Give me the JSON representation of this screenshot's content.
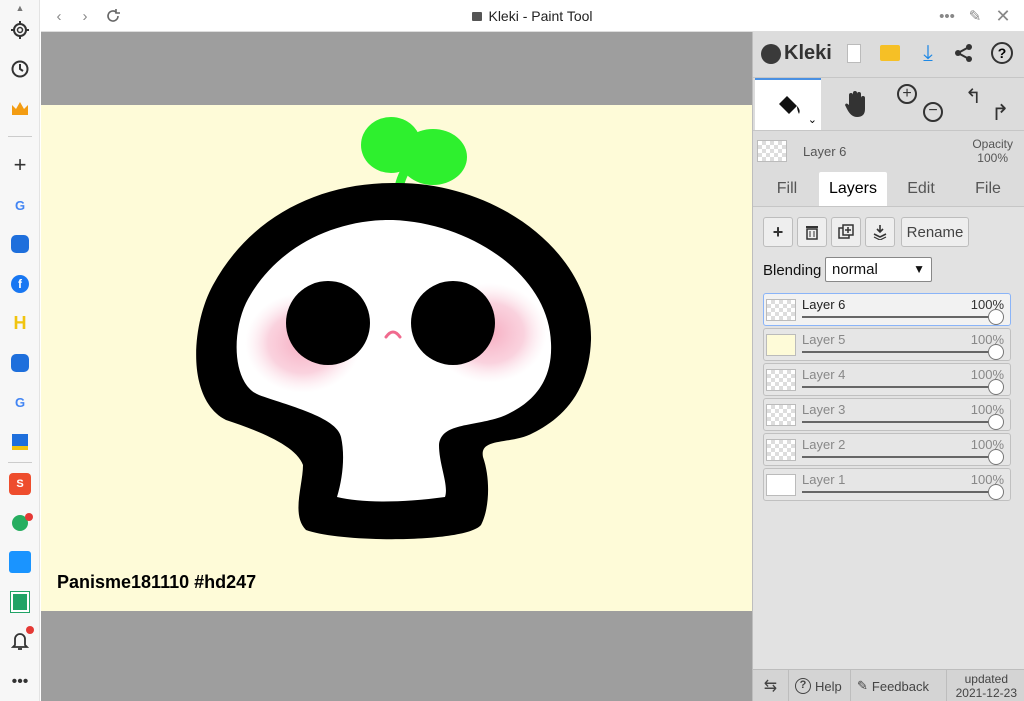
{
  "window": {
    "title": "Kleki - Paint Tool"
  },
  "canvas": {
    "caption": "Panisme181110 #hd247",
    "background": "#fefbd8"
  },
  "panel": {
    "logo_text": "Kleki",
    "current_layer": {
      "name": "Layer 6",
      "opacity_label": "Opacity",
      "opacity_value": "100%"
    },
    "tabs": [
      {
        "label": "Fill",
        "active": false
      },
      {
        "label": "Layers",
        "active": true
      },
      {
        "label": "Edit",
        "active": false
      },
      {
        "label": "File",
        "active": false
      }
    ],
    "layers_tab": {
      "rename_label": "Rename",
      "blending_label": "Blending",
      "blending_value": "normal",
      "layers": [
        {
          "name": "Layer 6",
          "opacity": "100%",
          "active": true
        },
        {
          "name": "Layer 5",
          "opacity": "100%",
          "active": false
        },
        {
          "name": "Layer 4",
          "opacity": "100%",
          "active": false
        },
        {
          "name": "Layer 3",
          "opacity": "100%",
          "active": false
        },
        {
          "name": "Layer 2",
          "opacity": "100%",
          "active": false
        },
        {
          "name": "Layer 1",
          "opacity": "100%",
          "active": false
        }
      ]
    },
    "footer": {
      "help_label": "Help",
      "feedback_label": "Feedback",
      "updated_label": "updated",
      "updated_date": "2021-12-23"
    }
  },
  "colors": {
    "accent": "#4a90e2",
    "sprout": "#2ef02e",
    "blush": "#f6b6c8"
  }
}
